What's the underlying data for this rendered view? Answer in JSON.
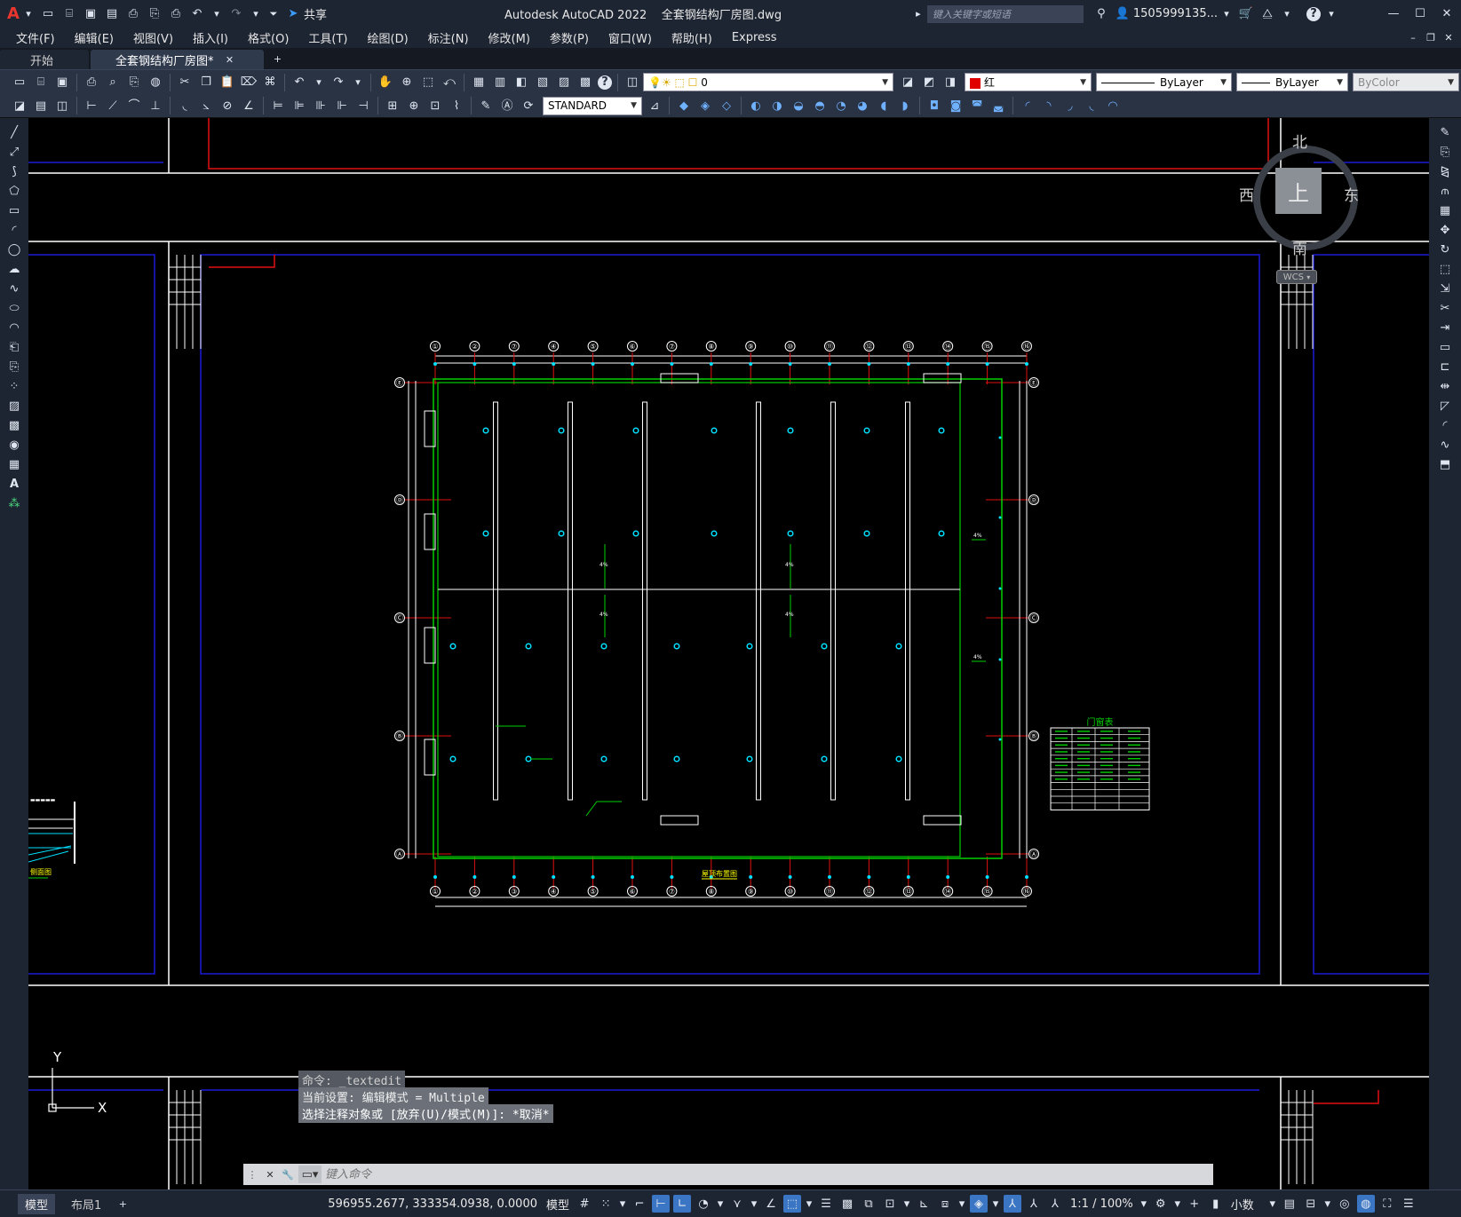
{
  "app": {
    "title": "Autodesk AutoCAD 2022",
    "filename": "全套钢结构厂房图.dwg",
    "logo": "A",
    "share": "共享",
    "search_placeholder": "键入关键字或短语",
    "user": "1505999135...",
    "help": "?"
  },
  "menu": [
    "文件(F)",
    "编辑(E)",
    "视图(V)",
    "插入(I)",
    "格式(O)",
    "工具(T)",
    "绘图(D)",
    "标注(N)",
    "修改(M)",
    "参数(P)",
    "窗口(W)",
    "帮助(H)",
    "Express"
  ],
  "tabs": [
    {
      "label": "开始",
      "active": false
    },
    {
      "label": "全套钢结构厂房图*",
      "active": true
    }
  ],
  "toolbar": {
    "layer_value": "0",
    "color_value": "红",
    "color_swatch": "#e00000",
    "linetype_value": "ByLayer",
    "lineweight_value": "ByLayer",
    "plotstyle_value": "ByColor",
    "textstyle_value": "STANDARD"
  },
  "viewcube": {
    "north": "北",
    "south": "南",
    "east": "东",
    "west": "西",
    "face": "上",
    "wcs": "WCS"
  },
  "drawing": {
    "grid_top_numbers": [
      "①",
      "②",
      "⑦",
      "④",
      "⑤",
      "⑥",
      "⑦",
      "⑧",
      "⑨",
      "⑩",
      "⑪",
      "⑫",
      "⑬",
      "⑭",
      "⑮",
      "⑯"
    ],
    "grid_bottom_numbers": [
      "①",
      "②",
      "③",
      "④",
      "⑤",
      "⑥",
      "⑦",
      "⑧",
      "⑨",
      "⑩",
      "⑪",
      "⑫",
      "⑬",
      "⑭",
      "⑮",
      "⑯"
    ],
    "grid_letters": [
      "Ⓔ",
      "Ⓓ",
      "Ⓒ",
      "Ⓑ",
      "Ⓐ"
    ],
    "table_title": "门窗表",
    "plan_title": "屋顶布置图",
    "side_label": "侧面图",
    "slope_label": "4%",
    "frame_top_label": "QLG"
  },
  "command": {
    "history": [
      "命令: _textedit",
      "当前设置: 编辑模式 = Multiple",
      "选择注释对象或 [放弃(U)/模式(M)]: *取消*"
    ],
    "placeholder": "键入命令"
  },
  "ucs": {
    "y": "Y",
    "x": "X"
  },
  "status": {
    "layout_tabs": [
      "模型",
      "布局1"
    ],
    "coords": "596955.2677, 333354.0938, 0.0000",
    "space": "模型",
    "scale": "1:1 / 100%",
    "units": "小数"
  },
  "colors": {
    "border_blue": "#1a1ad6",
    "frame_red": "#e01010",
    "wall_green": "#00d000",
    "point_cyan": "#00e0ff",
    "line_white": "#ffffff",
    "ui_dark": "#1e2532",
    "accent_blue": "#3b76c5"
  }
}
